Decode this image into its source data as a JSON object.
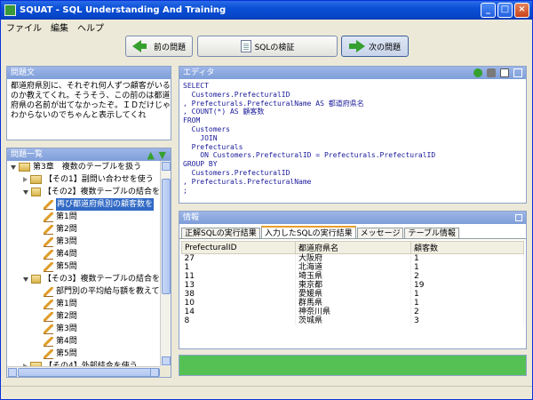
{
  "window": {
    "title": "SQUAT - SQL Understanding And Training"
  },
  "menu": [
    "ファイル",
    "編集",
    "ヘルプ"
  ],
  "toolbar": {
    "prev": "前の問題",
    "verify": "SQLの検証",
    "next": "次の問題"
  },
  "problem": {
    "title": "問題文",
    "lines": [
      "都道府県別に、それぞれ何人ずつ顧客がいる",
      "のか教えてくれ。そうそう、この前のは都道",
      "府県の名前が出てなかったぞ。ＩＤだけじゃ",
      "わからないのでちゃんと表示してくれ"
    ]
  },
  "list": {
    "title": "問題一覧",
    "rows": [
      {
        "indent": 0,
        "icon": "folder",
        "tri": "open",
        "text": "第3章　複数のテーブルを扱う"
      },
      {
        "indent": 1,
        "icon": "folder",
        "tri": "closed",
        "text": "【その1】副問い合わせを使う"
      },
      {
        "indent": 1,
        "icon": "folder",
        "tri": "open",
        "text": "【その2】複数テーブルの結合を"
      },
      {
        "indent": 2,
        "icon": "pencil",
        "tri": "",
        "text": "再び都道府県別の顧客数を",
        "selected": true
      },
      {
        "indent": 2,
        "icon": "pencil",
        "tri": "",
        "text": "第1問"
      },
      {
        "indent": 2,
        "icon": "pencil",
        "tri": "",
        "text": "第2問"
      },
      {
        "indent": 2,
        "icon": "pencil",
        "tri": "",
        "text": "第3問"
      },
      {
        "indent": 2,
        "icon": "pencil",
        "tri": "",
        "text": "第4問"
      },
      {
        "indent": 2,
        "icon": "pencil",
        "tri": "",
        "text": "第5問"
      },
      {
        "indent": 1,
        "icon": "folder",
        "tri": "open",
        "text": "【その3】複数テーブルの結合を"
      },
      {
        "indent": 2,
        "icon": "pencil",
        "tri": "",
        "text": "部門別の平均給与額を教えて"
      },
      {
        "indent": 2,
        "icon": "pencil",
        "tri": "",
        "text": "第1問"
      },
      {
        "indent": 2,
        "icon": "pencil",
        "tri": "",
        "text": "第2問"
      },
      {
        "indent": 2,
        "icon": "pencil",
        "tri": "",
        "text": "第3問"
      },
      {
        "indent": 2,
        "icon": "pencil",
        "tri": "",
        "text": "第4問"
      },
      {
        "indent": 2,
        "icon": "pencil",
        "tri": "",
        "text": "第5問"
      },
      {
        "indent": 1,
        "icon": "folder",
        "tri": "closed",
        "text": "【その4】外部結合を使う"
      }
    ]
  },
  "editor": {
    "title": "エディタ",
    "lines": [
      "SELECT",
      "  Customers.PrefecturalID",
      ", Prefecturals.PrefecturalName AS 都道府県名",
      ", COUNT(*) AS 顧客数",
      "FROM",
      "  Customers",
      "    JOIN",
      "  Prefecturals",
      "    ON Customers.PrefecturalID = Prefecturals.PrefecturalID",
      "GROUP BY",
      "  Customers.PrefecturalID",
      ", Prefecturals.PrefecturalName",
      ";"
    ]
  },
  "info": {
    "title": "情報",
    "tabs": [
      "正解SQLの実行結果",
      "入力したSQLの実行結果",
      "メッセージ",
      "テーブル情報"
    ],
    "active_tab": 1,
    "columns": [
      "PrefecturalID",
      "都道府県名",
      "顧客数"
    ],
    "rows": [
      [
        "27",
        "大阪府",
        "1"
      ],
      [
        "1",
        "北海道",
        "1"
      ],
      [
        "11",
        "埼玉県",
        "2"
      ],
      [
        "13",
        "東京都",
        "19"
      ],
      [
        "38",
        "愛媛県",
        "1"
      ],
      [
        "10",
        "群馬県",
        "1"
      ],
      [
        "14",
        "神奈川県",
        "2"
      ],
      [
        "8",
        "茨城県",
        "3"
      ]
    ]
  },
  "colors": {
    "title_bar": "#0a4fd6",
    "panel_head": "#7e9ed8",
    "success_bar": "#55c155",
    "arrow": "#35a02f"
  }
}
